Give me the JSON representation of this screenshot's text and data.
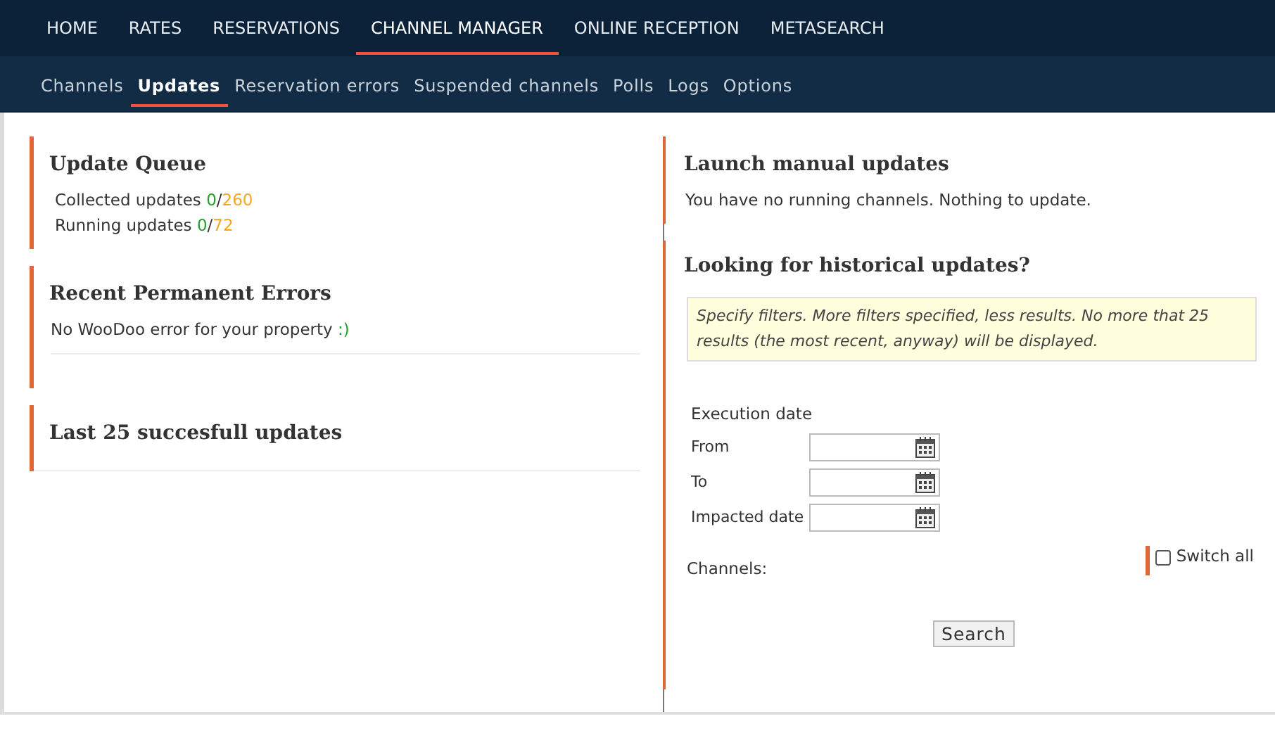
{
  "main_nav": [
    {
      "label": "HOME",
      "selected": false
    },
    {
      "label": "RATES",
      "selected": false
    },
    {
      "label": "RESERVATIONS",
      "selected": false
    },
    {
      "label": "CHANNEL MANAGER",
      "selected": true
    },
    {
      "label": "ONLINE RECEPTION",
      "selected": false
    },
    {
      "label": "METASEARCH",
      "selected": false
    }
  ],
  "sub_nav": [
    {
      "label": "Channels",
      "selected": false
    },
    {
      "label": "Updates",
      "selected": true
    },
    {
      "label": "Reservation errors",
      "selected": false
    },
    {
      "label": "Suspended channels",
      "selected": false
    },
    {
      "label": "Polls",
      "selected": false
    },
    {
      "label": "Logs",
      "selected": false
    },
    {
      "label": "Options",
      "selected": false
    }
  ],
  "update_queue": {
    "title": "Update Queue",
    "rows": [
      {
        "label": "Collected updates",
        "done": "0",
        "separator": "/",
        "total": "260"
      },
      {
        "label": "Running updates",
        "done": "0",
        "separator": "/",
        "total": "72"
      }
    ]
  },
  "permanent_errors": {
    "title": "Recent Permanent Errors",
    "message": "No WooDoo error for your property",
    "smiley": ":)"
  },
  "last_updates": {
    "title": "Last 25 succesfull updates"
  },
  "manual_updates": {
    "title": "Launch manual updates",
    "message": "You have no running channels. Nothing to update."
  },
  "historical": {
    "title": "Looking for historical updates?",
    "notice": "Specify filters. More filters specified, less results. No more that 25 results (the most recent, anyway) will be displayed.",
    "group_label": "Execution date",
    "fields": [
      {
        "label": "From"
      },
      {
        "label": "To"
      },
      {
        "label": "Impacted date"
      }
    ],
    "channels_label": "Channels:",
    "switch_all": {
      "label": "Switch all",
      "checked": false
    },
    "search_button": "Search"
  }
}
